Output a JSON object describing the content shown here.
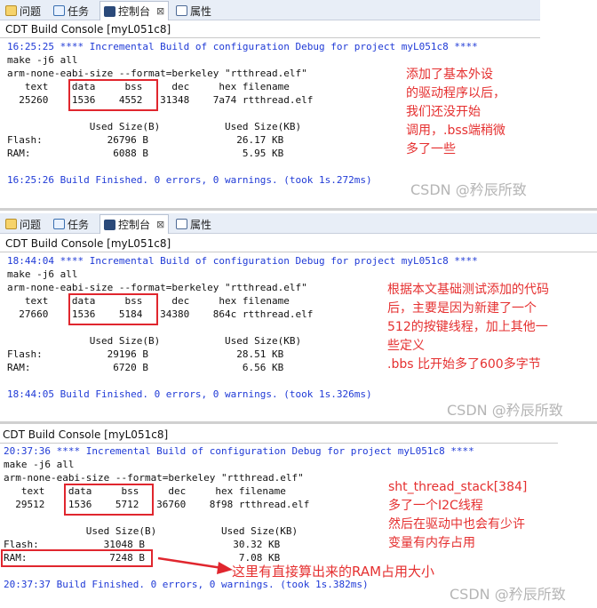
{
  "tabs": {
    "problems": "问题",
    "tasks": "任务",
    "console": "控制台",
    "console_close": "⊠",
    "properties": "属性"
  },
  "console_title": "CDT Build Console [myL051c8]",
  "blocks": [
    {
      "header": "16:25:25 **** Incremental Build of configuration Debug for project myL051c8 ****",
      "cmd1": "make -j6 all",
      "cmd2": "arm-none-eabi-size --format=berkeley \"rtthread.elf\"",
      "size_header": "   text    data     bss     dec     hex filename",
      "size_values": "  25260    1536    4552   31348    7a74 rtthread.elf",
      "used_header": "              Used Size(B)           Used Size(KB)",
      "flash": "Flash:           26796 B               26.17 KB",
      "ram": "RAM:              6088 B                5.95 KB",
      "finished": "16:25:26 Build Finished. 0 errors, 0 warnings. (took 1s.272ms)",
      "note": "添加了基本外设\n的驱动程序以后，\n我们还没开始\n调用，.bss端稍微\n多了一些",
      "watermark": "CSDN @矜辰所致"
    },
    {
      "header": "18:44:04 **** Incremental Build of configuration Debug for project myL051c8 ****",
      "cmd1": "make -j6 all",
      "cmd2": "arm-none-eabi-size --format=berkeley \"rtthread.elf\"",
      "size_header": "   text    data     bss     dec     hex filename",
      "size_values": "  27660    1536    5184   34380    864c rtthread.elf",
      "used_header": "              Used Size(B)           Used Size(KB)",
      "flash": "Flash:           29196 B               28.51 KB",
      "ram": "RAM:              6720 B                6.56 KB",
      "finished": "18:44:05 Build Finished. 0 errors, 0 warnings. (took 1s.326ms)",
      "note": "根据本文基础测试添加的代码\n后，主要是因为新建了一个\n512的按键线程，加上其他一\n些定义\n.bbs 比开始多了600多字节",
      "watermark": "CSDN @矜辰所致"
    },
    {
      "header": "20:37:36 **** Incremental Build of configuration Debug for project myL051c8 ****",
      "cmd1": "make -j6 all",
      "cmd2": "arm-none-eabi-size --format=berkeley \"rtthread.elf\"",
      "size_header": "   text    data     bss     dec     hex filename",
      "size_values": "  29512    1536    5712   36760    8f98 rtthread.elf",
      "used_header": "              Used Size(B)           Used Size(KB)",
      "flash": "Flash:           31048 B               30.32 KB",
      "ram": "RAM:              7248 B                7.08 KB",
      "finished": "20:37:37 Build Finished. 0 errors, 0 warnings. (took 1s.382ms)",
      "note": "sht_thread_stack[384]\n多了一个I2C线程\n然后在驱动中也会有少许\n变量有内存占用",
      "arrow_note": "这里有直接算出来的RAM占用大小",
      "watermark": "CSDN @矜辰所致"
    }
  ],
  "colors": {
    "annotation": "#e53030",
    "status_blue": "#1f3ad6",
    "box_red": "#e0262e"
  }
}
